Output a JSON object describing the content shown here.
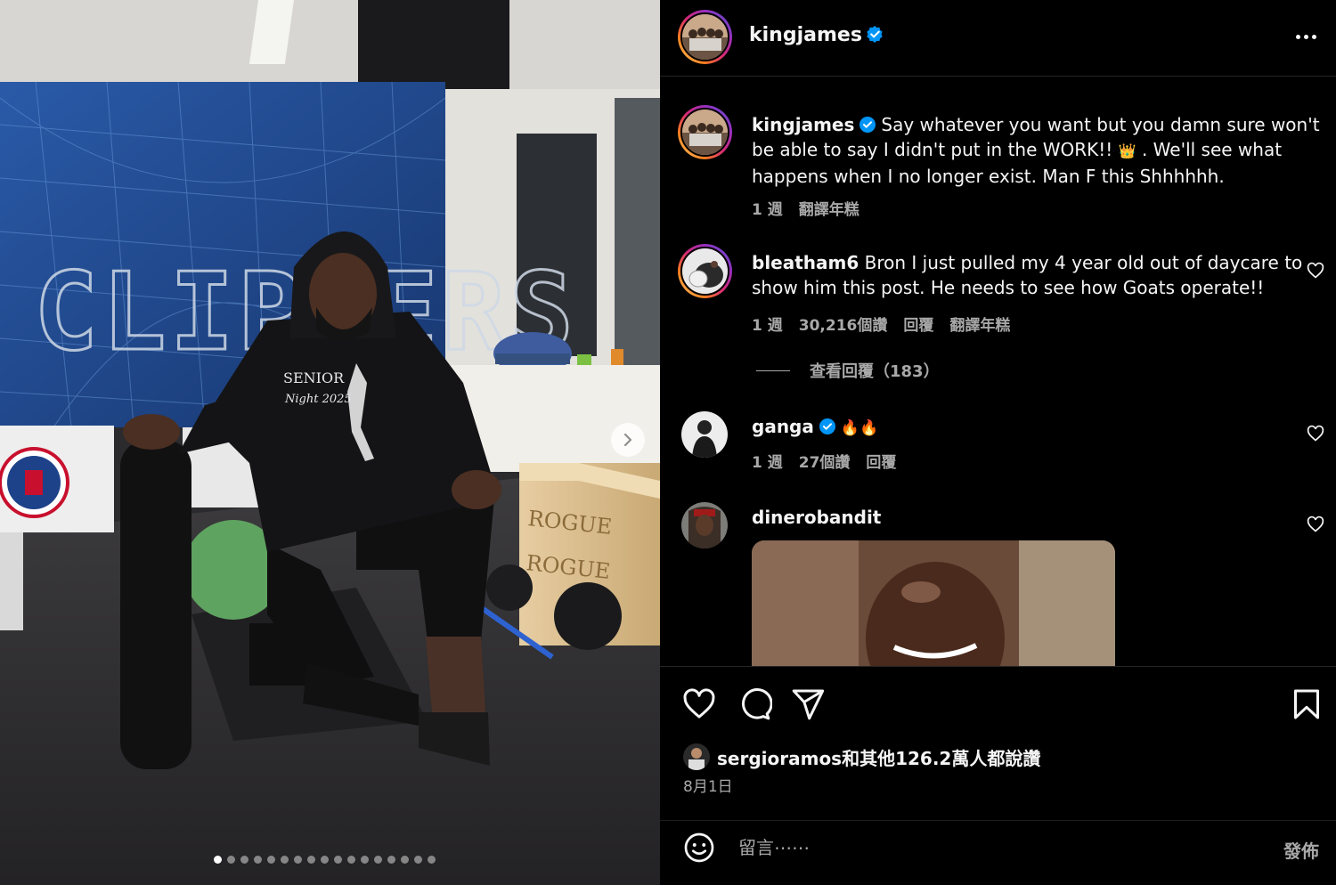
{
  "media": {
    "wall_text": "CLIPPERS",
    "hoodie_text_1": "SENIOR",
    "hoodie_text_2": "Night 2025",
    "crate_text": "ROGUE",
    "slide_count": 17,
    "active_slide": 1,
    "next_icon": "chevron-right-icon"
  },
  "header": {
    "username": "kingjames",
    "verified": true,
    "more_icon": "more-horizontal-icon"
  },
  "caption": {
    "username": "kingjames",
    "text_before_emoji": "Say whatever you want but you damn sure won't be able to say I didn't put in the WORK!! ",
    "emoji": "👑",
    "text_after_emoji": " . We'll see what happens when I no longer exist. Man F this Shhhhhh.",
    "time": "1 週",
    "translate": "翻譯年糕"
  },
  "comments": [
    {
      "username": "bleatham6",
      "text": "Bron I just pulled my 4 year old out of daycare to show him this post. He needs to see how Goats operate!!",
      "time": "1 週",
      "likes": "30,216個讚",
      "reply": "回覆",
      "translate": "翻譯年糕",
      "view_replies": "查看回覆（183）"
    },
    {
      "username": "ganga",
      "verified": true,
      "text": "🔥🔥",
      "time": "1 週",
      "likes": "27個讚",
      "reply": "回覆"
    },
    {
      "username": "dinerobandit",
      "text": ""
    }
  ],
  "actions": {
    "like_icon": "heart-icon",
    "comment_icon": "comment-icon",
    "share_icon": "send-icon",
    "save_icon": "bookmark-icon"
  },
  "likes_text": "sergioramos和其他126.2萬人都說讚",
  "date": "8月1日",
  "add_comment": {
    "placeholder": "留言⋯⋯",
    "post_label": "發佈",
    "emoji_icon": "emoji-icon"
  },
  "colors": {
    "background": "#000000",
    "text": "#f5f5f5",
    "secondary_text": "#a8a8a8",
    "verified_blue": "#0095f6"
  }
}
